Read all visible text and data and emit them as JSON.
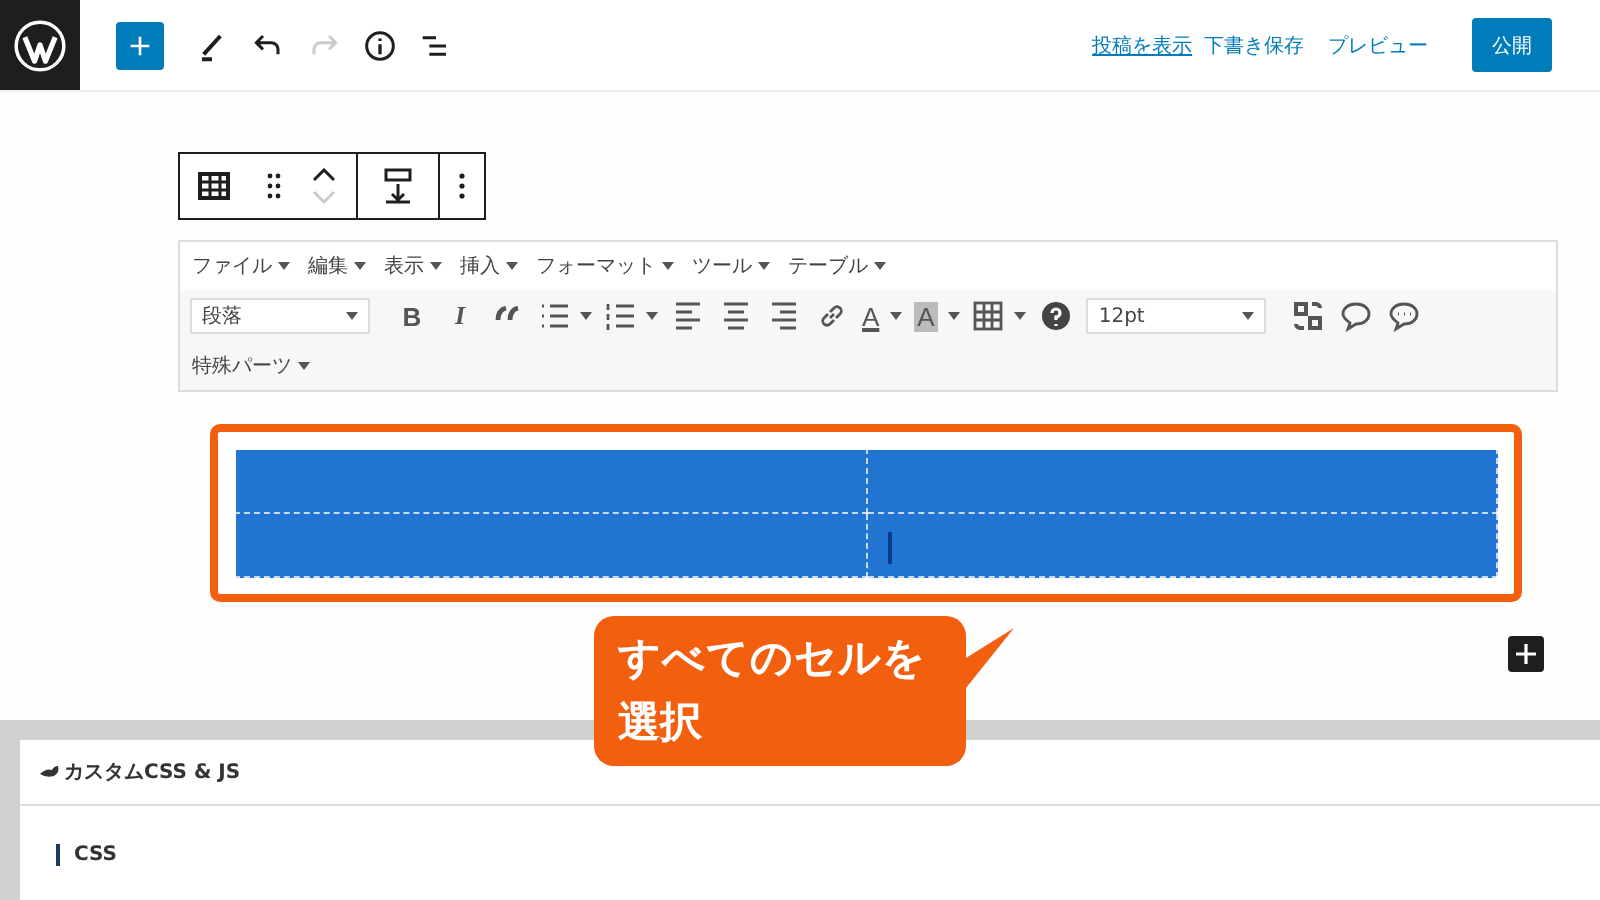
{
  "topbar": {
    "tools": [
      {
        "kind": "add",
        "disabled": false
      },
      {
        "kind": "pencil",
        "disabled": false
      },
      {
        "kind": "undo",
        "disabled": false
      },
      {
        "kind": "redo",
        "disabled": true
      },
      {
        "kind": "info",
        "disabled": false
      },
      {
        "kind": "outline",
        "disabled": false
      }
    ],
    "links": [
      {
        "label": "投稿を表示",
        "underlined": true
      },
      {
        "label": "下書き保存",
        "underlined": false
      },
      {
        "label": "プレビュー",
        "underlined": false
      }
    ],
    "publish_button": "公開"
  },
  "block_toolbar": [
    {
      "kind": "table"
    },
    {
      "kind": "drag"
    },
    {
      "kind": "mover"
    },
    {
      "kind": "align"
    },
    {
      "kind": "more"
    }
  ],
  "classic_editor": {
    "menus": [
      "ファイル",
      "編集",
      "表示",
      "挿入",
      "フォーマット",
      "ツール",
      "テーブル"
    ],
    "toolbar": [
      {
        "kind": "select",
        "text": "段落"
      },
      {
        "kind": "bold",
        "text": "B"
      },
      {
        "kind": "italic",
        "text": "I"
      },
      {
        "kind": "quote"
      },
      {
        "kind": "bullist"
      },
      {
        "kind": "numlist"
      },
      {
        "kind": "alignleft"
      },
      {
        "kind": "aligncenter"
      },
      {
        "kind": "alignright"
      },
      {
        "kind": "link"
      },
      {
        "kind": "forecolor",
        "text": "A"
      },
      {
        "kind": "backcolor",
        "text": "A"
      },
      {
        "kind": "table"
      },
      {
        "kind": "help"
      },
      {
        "kind": "select",
        "text": "12pt"
      },
      {
        "kind": "translate"
      },
      {
        "kind": "comment"
      },
      {
        "kind": "comments"
      }
    ],
    "extra_menu": "特殊パーツ"
  },
  "table": {
    "highlighted": true,
    "rows": [
      {
        "cells": [
          {
            "selected": true,
            "caret": false
          },
          {
            "selected": true,
            "caret": false
          }
        ]
      },
      {
        "cells": [
          {
            "selected": true,
            "caret": false
          },
          {
            "selected": true,
            "caret": true
          }
        ]
      }
    ]
  },
  "callout": {
    "text": "すべてのセルを選択"
  },
  "panel": {
    "title": "カスタムCSS & JS",
    "section": "CSS"
  }
}
